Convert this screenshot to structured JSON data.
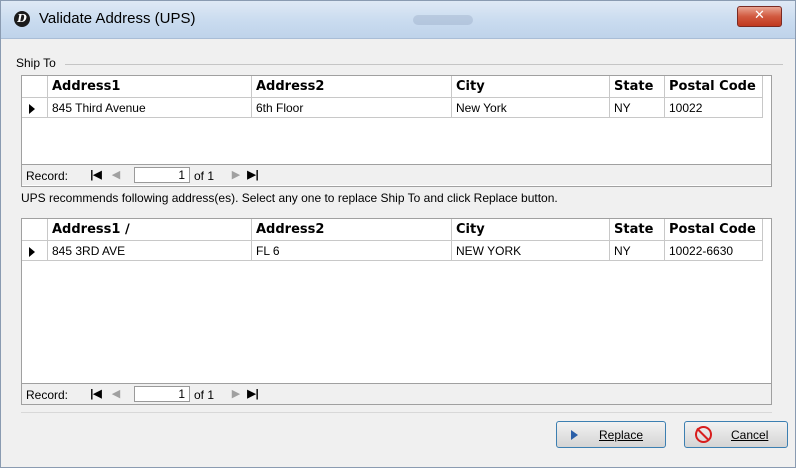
{
  "window": {
    "title": "Validate Address (UPS)"
  },
  "ship_to": {
    "group_label": "Ship To",
    "columns": [
      "Address1",
      "Address2",
      "City",
      "State",
      "Postal Code"
    ],
    "rows": [
      [
        "845  Third Avenue",
        "6th Floor",
        "New York",
        "NY",
        "10022"
      ]
    ],
    "nav": {
      "label": "Record:",
      "current": "1",
      "of_text": "of 1"
    }
  },
  "recommend_text": "UPS recommends following address(es). Select any one to replace Ship To and click Replace button.",
  "recommended": {
    "columns": [
      "Address1 ∕",
      "Address2",
      "City",
      "State",
      "Postal Code"
    ],
    "rows": [
      [
        "845 3RD AVE",
        "FL 6",
        "NEW YORK",
        "NY",
        "10022-6630"
      ]
    ],
    "nav": {
      "label": "Record:",
      "current": "1",
      "of_text": "of 1"
    }
  },
  "buttons": {
    "replace_label": "Replace",
    "cancel_label": "Cancel"
  },
  "colors": {
    "close_button": "#c8442b",
    "button_border": "#3c7fb1",
    "cancel_icon": "#d81d1d"
  }
}
